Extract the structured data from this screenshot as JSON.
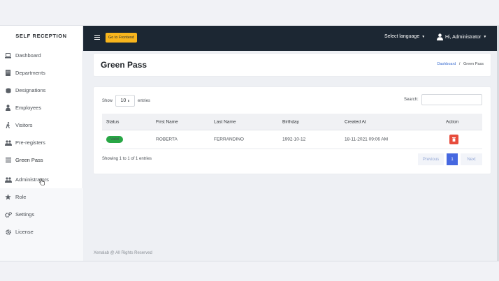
{
  "sidebar": {
    "brand": "SELF RECEPTION",
    "items": [
      {
        "label": "Dashboard",
        "icon": "laptop-icon"
      },
      {
        "label": "Departments",
        "icon": "building-icon"
      },
      {
        "label": "Designations",
        "icon": "layers-icon"
      },
      {
        "label": "Employees",
        "icon": "user-tie-icon"
      },
      {
        "label": "Visitors",
        "icon": "walking-icon"
      },
      {
        "label": "Pre-registers",
        "icon": "users-icon"
      },
      {
        "label": "Green Pass",
        "icon": "list-icon"
      },
      {
        "label": "Administrators",
        "icon": "users-cog-icon"
      },
      {
        "label": "Role",
        "icon": "star-icon"
      },
      {
        "label": "Settings",
        "icon": "gears-icon"
      },
      {
        "label": "License",
        "icon": "gear-icon"
      }
    ]
  },
  "topbar": {
    "frontend_button": "Go to Frontend",
    "language": "Select language",
    "user": "Hi, Administrator"
  },
  "page": {
    "title": "Green Pass",
    "breadcrumb_home": "Dashboard",
    "breadcrumb_sep": "/",
    "breadcrumb_current": "Green Pass"
  },
  "table": {
    "show_label": "Show",
    "entries_value": "10",
    "entries_label": "entries",
    "search_label": "Search:",
    "columns": [
      "Status",
      "First Name",
      "Last Name",
      "Birthday",
      "Created At",
      "Action"
    ],
    "rows": [
      {
        "status": "Valid",
        "first_name": "ROBERTA",
        "last_name": "FERRANDINO",
        "birthday": "1992-10-12",
        "created_at": "18-11-2021 09:06 AM"
      }
    ],
    "info": "Showing 1 to 1 of 1 entries",
    "pagination": {
      "previous": "Previous",
      "current": "1",
      "next": "Next"
    }
  },
  "footer": "Xenalab @ All Rights Reserved",
  "colors": {
    "topbar": "#1c2733",
    "accent_yellow": "#f8b51d",
    "valid_green": "#28a745",
    "delete_red": "#e74c3c",
    "page_blue": "#4668e0"
  }
}
